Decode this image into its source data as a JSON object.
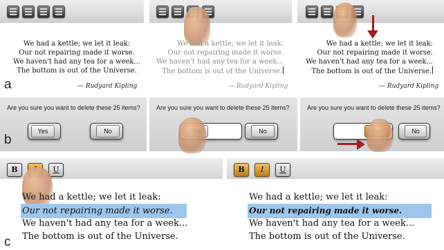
{
  "poem": {
    "lines": [
      "We had a kettle; we let it leak:",
      "Our not repairing made it worse.",
      "We haven't had any tea for a week...",
      "The bottom is out of the Universe."
    ],
    "attribution": "— Rudyard Kipling"
  },
  "labels": {
    "a": "a",
    "b": "b",
    "c": "c"
  },
  "dialog": {
    "question": "Are you sure you want to delete these 25 items?",
    "yes_label": "Yes",
    "no_label": "No"
  },
  "format_toolbar": {
    "bold": "B",
    "italic": "I",
    "underline": "U"
  },
  "colors": {
    "accent": "#c88a2a",
    "selection": "#9dc6ec",
    "arrow": "#a31e1e"
  },
  "icons": [
    "align-left-icon",
    "align-center-icon",
    "align-right-icon",
    "justify-icon"
  ]
}
